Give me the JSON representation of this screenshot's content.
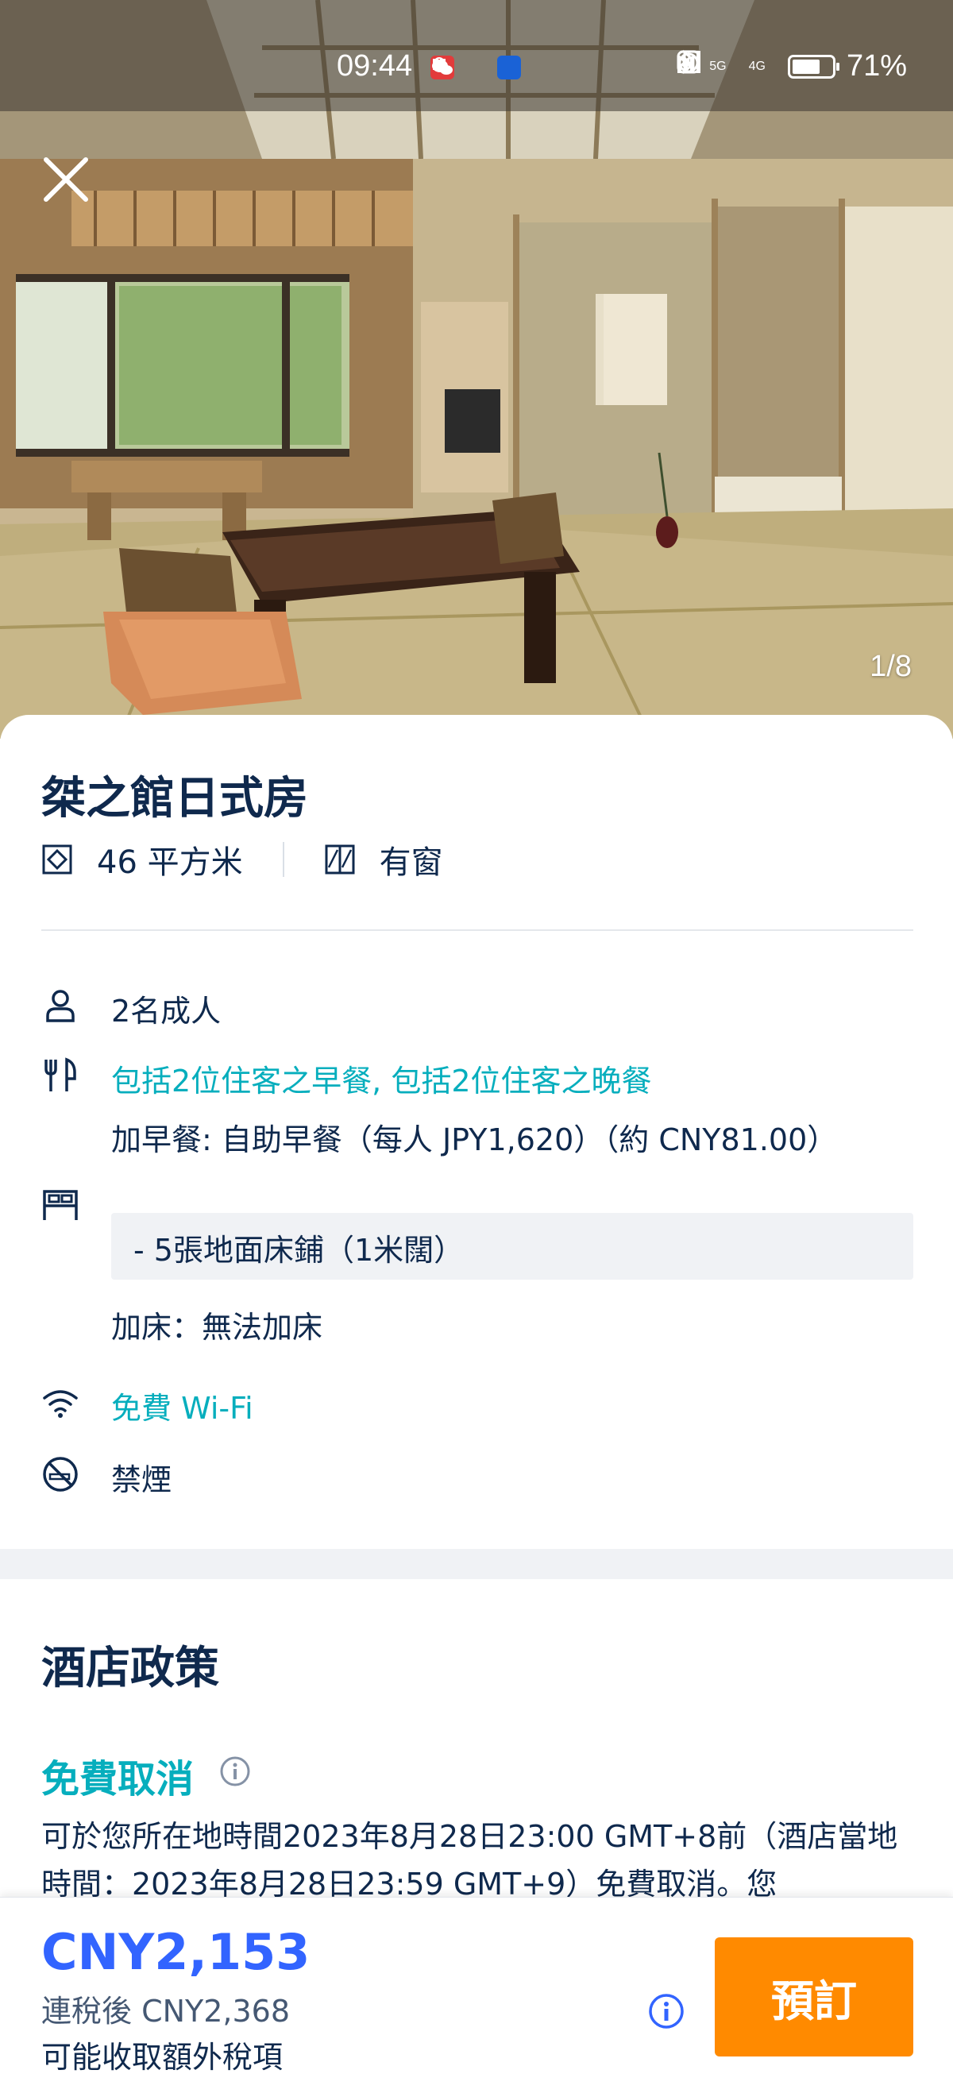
{
  "status_bar": {
    "time": "09:44",
    "network_1": "5G",
    "network_2": "4G",
    "battery_percent": "71%",
    "battery_level": 0.71
  },
  "gallery": {
    "counter": "1/8"
  },
  "room": {
    "title": "桀之館日式房",
    "area": "46 平方米",
    "window": "有窗",
    "occupancy": "2名成人",
    "meals": "包括2位住客之早餐, 包括2位住客之晚餐",
    "extra_breakfast": "加早餐: 自助早餐（每人 JPY1,620）（約 CNY81.00）",
    "beds": "- 5張地面床鋪（1米闊）",
    "extra_bed": "加床：無法加床",
    "wifi": "免費 Wi-Fi",
    "smoking": "禁煙"
  },
  "policy": {
    "title": "酒店政策",
    "cancel_title": "免費取消",
    "cancel_text": "可於您所在地時間2023年8月28日23:00 GMT+8前（酒店當地時間：2023年8月28日23:59 GMT+9）免費取消。您"
  },
  "booking": {
    "price": "CNY2,153",
    "price_with_tax": "連稅後 CNY2,368",
    "tax_note": "可能收取額外稅項",
    "book_label": "預訂"
  },
  "colors": {
    "accent_teal": "#06aebd",
    "price_blue": "#3264ff",
    "book_orange": "#ff8a00",
    "text_navy": "#0f294d"
  }
}
